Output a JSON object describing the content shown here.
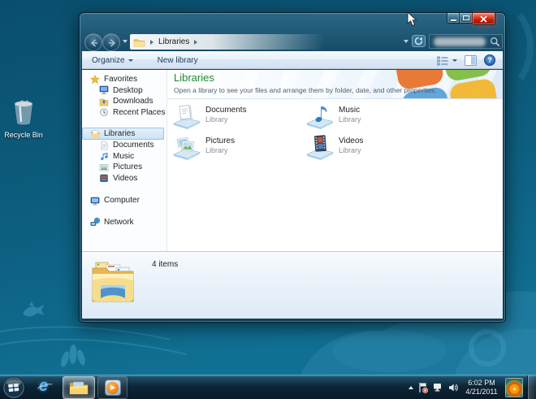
{
  "desktop": {
    "recycle_bin": {
      "label": "Recycle Bin"
    }
  },
  "window": {
    "address_bar": {
      "location": "Libraries"
    },
    "toolbar": {
      "organize": "Organize",
      "new_library": "New library"
    },
    "sidebar": {
      "sections": [
        {
          "label": "Favorites",
          "children": [
            {
              "label": "Desktop"
            },
            {
              "label": "Downloads"
            },
            {
              "label": "Recent Places"
            }
          ]
        },
        {
          "label": "Libraries",
          "selected": true,
          "children": [
            {
              "label": "Documents"
            },
            {
              "label": "Music"
            },
            {
              "label": "Pictures"
            },
            {
              "label": "Videos"
            }
          ]
        },
        {
          "label": "Computer",
          "children": []
        },
        {
          "label": "Network",
          "children": []
        }
      ]
    },
    "content": {
      "title": "Libraries",
      "subtitle": "Open a library to see your files and arrange them by folder, date, and other properties.",
      "items": [
        {
          "name": "Documents",
          "kind": "Library"
        },
        {
          "name": "Music",
          "kind": "Library"
        },
        {
          "name": "Pictures",
          "kind": "Library"
        },
        {
          "name": "Videos",
          "kind": "Library"
        }
      ]
    },
    "details": {
      "count": "4 items"
    }
  },
  "taskbar": {
    "clock": {
      "time": "6:02 PM",
      "date": "4/21/2011"
    }
  },
  "colors": {
    "selection_blue": "#cbe2f6",
    "header_green": "#208a30",
    "close_red": "#e0402f",
    "desktop_teal": "#0e6284"
  }
}
